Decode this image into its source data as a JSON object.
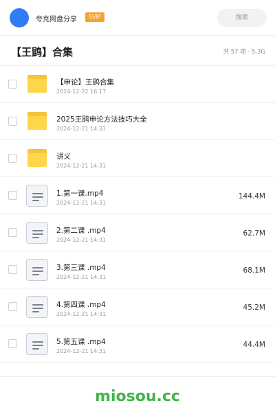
{
  "topbar": {
    "app_name": "夸克网盘分享",
    "badge": "SVIP",
    "search_placeholder": "搜索",
    "avatar_color": "#2f7cf6",
    "badge_color": "#f7a330"
  },
  "header": {
    "title": "【王鹍】合集",
    "stats": "共 57 项 · 5.3G"
  },
  "files": [
    {
      "type": "folder",
      "icon": "folder-icon",
      "name": "【申论】王鹍合集",
      "date": "2024-12-22 16:17",
      "size": ""
    },
    {
      "type": "folder",
      "icon": "folder-icon",
      "name": "2025王鹍申论方法技巧大全",
      "date": "2024-12-21 14:31",
      "size": ""
    },
    {
      "type": "folder",
      "icon": "folder-icon",
      "name": "讲义",
      "date": "2024-12-21 14:31",
      "size": ""
    },
    {
      "type": "file",
      "icon": "video-file-icon",
      "name": "1.第一课.mp4",
      "date": "2024-12-21 14:31",
      "size": "144.4M"
    },
    {
      "type": "file",
      "icon": "video-file-icon",
      "name": "2.第二课 .mp4",
      "date": "2024-12-21 14:31",
      "size": "62.7M"
    },
    {
      "type": "file",
      "icon": "video-file-icon",
      "name": "3.第三课 .mp4",
      "date": "2024-12-21 14:31",
      "size": "68.1M"
    },
    {
      "type": "file",
      "icon": "video-file-icon",
      "name": "4.第四课 .mp4",
      "date": "2024-12-21 14:31",
      "size": "45.2M"
    },
    {
      "type": "file",
      "icon": "video-file-icon",
      "name": "5.第五课 .mp4",
      "date": "2024-12-21 14:31",
      "size": "44.4M"
    }
  ],
  "footer": {
    "brand": "miosou.cc",
    "brand_color": "#45b34a"
  }
}
